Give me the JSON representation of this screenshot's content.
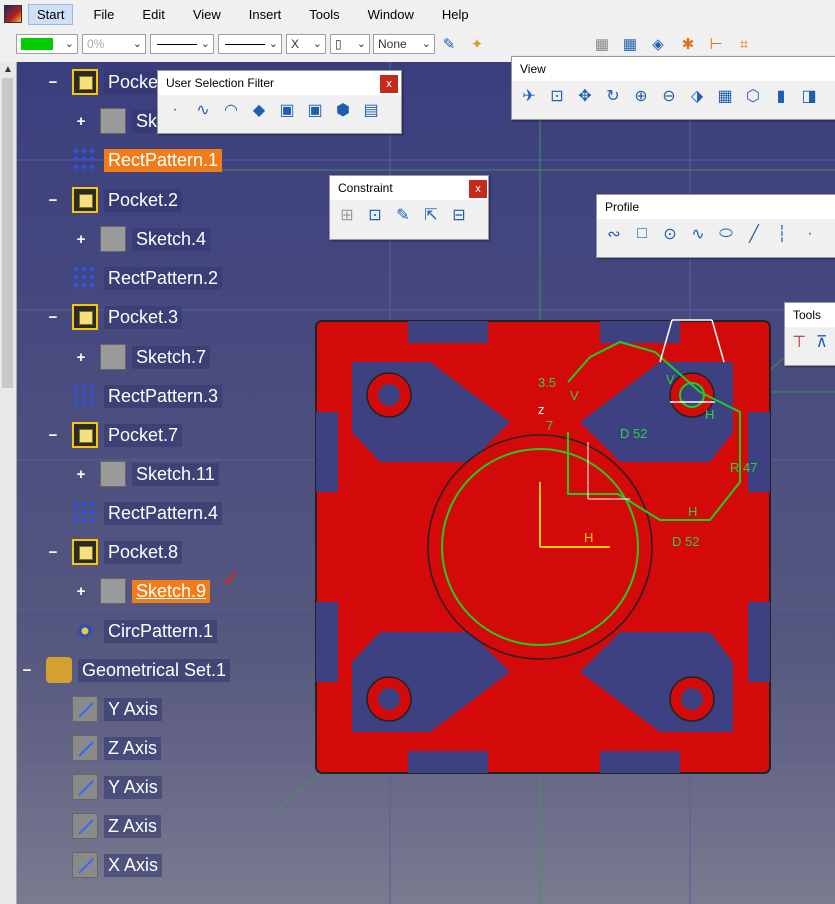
{
  "menubar": {
    "items": [
      "Start",
      "File",
      "Edit",
      "View",
      "Insert",
      "Tools",
      "Window",
      "Help"
    ]
  },
  "toolbar": {
    "color_swatch": "#00cc00",
    "transparency": "0%",
    "line_weight_symbol": "X",
    "layer_value": "None",
    "icons": [
      "paint-brush-icon",
      "magic-wand-icon",
      "grid-snap-icon",
      "grid-icon",
      "cut-plane-icon",
      "sketch-tool-icon",
      "constraint-tool-icon",
      "dimension-tool-icon"
    ]
  },
  "tree": {
    "items": [
      {
        "label": "Pocke",
        "icon": "pocket-icon",
        "depth": 1
      },
      {
        "label": "Sk",
        "icon": "sketch-icon",
        "depth": 2
      },
      {
        "label": "RectPattern.1",
        "icon": "pattern-icon",
        "depth": 1,
        "highlight": true
      },
      {
        "label": "Pocket.2",
        "icon": "pocket-icon",
        "depth": 1
      },
      {
        "label": "Sketch.4",
        "icon": "sketch-icon",
        "depth": 2
      },
      {
        "label": "RectPattern.2",
        "icon": "pattern-icon",
        "depth": 1
      },
      {
        "label": "Pocket.3",
        "icon": "pocket-icon",
        "depth": 1
      },
      {
        "label": "Sketch.7",
        "icon": "sketch-icon",
        "depth": 2
      },
      {
        "label": "RectPattern.3",
        "icon": "pattern-icon",
        "depth": 1
      },
      {
        "label": "Pocket.7",
        "icon": "pocket-icon",
        "depth": 1
      },
      {
        "label": "Sketch.11",
        "icon": "sketch-icon",
        "depth": 2
      },
      {
        "label": "RectPattern.4",
        "icon": "pattern-icon",
        "depth": 1
      },
      {
        "label": "Pocket.8",
        "icon": "pocket-icon",
        "depth": 1
      },
      {
        "label": "Sketch.9",
        "icon": "sketch-icon",
        "depth": 2,
        "active": true
      },
      {
        "label": "CircPattern.1",
        "icon": "circ-pattern-icon",
        "depth": 1
      },
      {
        "label": "Geometrical Set.1",
        "icon": "geometrical-set-icon",
        "depth": 0
      },
      {
        "label": "Y Axis",
        "icon": "axis-icon",
        "depth": 1
      },
      {
        "label": "Z Axis",
        "icon": "axis-icon",
        "depth": 1
      },
      {
        "label": "Y Axis",
        "icon": "axis-icon",
        "depth": 1
      },
      {
        "label": "Z Axis",
        "icon": "axis-icon",
        "depth": 1
      },
      {
        "label": "X Axis",
        "icon": "axis-icon",
        "depth": 1
      }
    ]
  },
  "panels": {
    "user_selection_filter": {
      "title": "User Selection Filter",
      "close": "x"
    },
    "constraint": {
      "title": "Constraint",
      "close": "x"
    },
    "view": {
      "title": "View"
    },
    "profile": {
      "title": "Profile"
    },
    "tools": {
      "title": "Tools"
    }
  },
  "sketch_labels": {
    "dim1": "3.5",
    "dim2": "7",
    "dim3": "D 52",
    "dim4": "R 47",
    "dim5": "D 52",
    "v1": "V",
    "v2": "V",
    "h1": "H",
    "h2": "H",
    "h3": "H",
    "z": "z"
  },
  "colors": {
    "part": "#d40a0a",
    "sketch": "#22cc22",
    "axis": "#ffcc00",
    "highlight": "#f07d1a",
    "background": "#3a3e7e"
  }
}
